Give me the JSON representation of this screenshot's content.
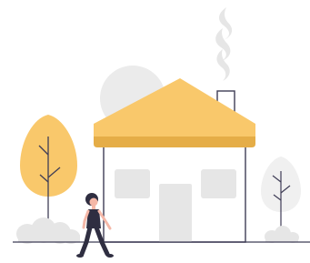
{
  "scene": {
    "subject": "house-with-walking-person",
    "colors": {
      "roof": "#f9c86b",
      "roof_eave": "#e5ad47",
      "tree_foliage": "#f9c86b",
      "pale_foliage": "#f0f0f0",
      "grey_shape": "#e6e6e6",
      "outline": "#3f3d56",
      "window": "#e6e6e6",
      "skin": "#f5b8a8",
      "hair": "#2f2e41",
      "clothing": "#2f2e41",
      "ground_line": "#3f3d56"
    },
    "elements": [
      "chimney-smoke",
      "sun-circle",
      "house",
      "yellow-tree",
      "pale-tree",
      "bushes",
      "walking-woman",
      "ground-line"
    ]
  }
}
